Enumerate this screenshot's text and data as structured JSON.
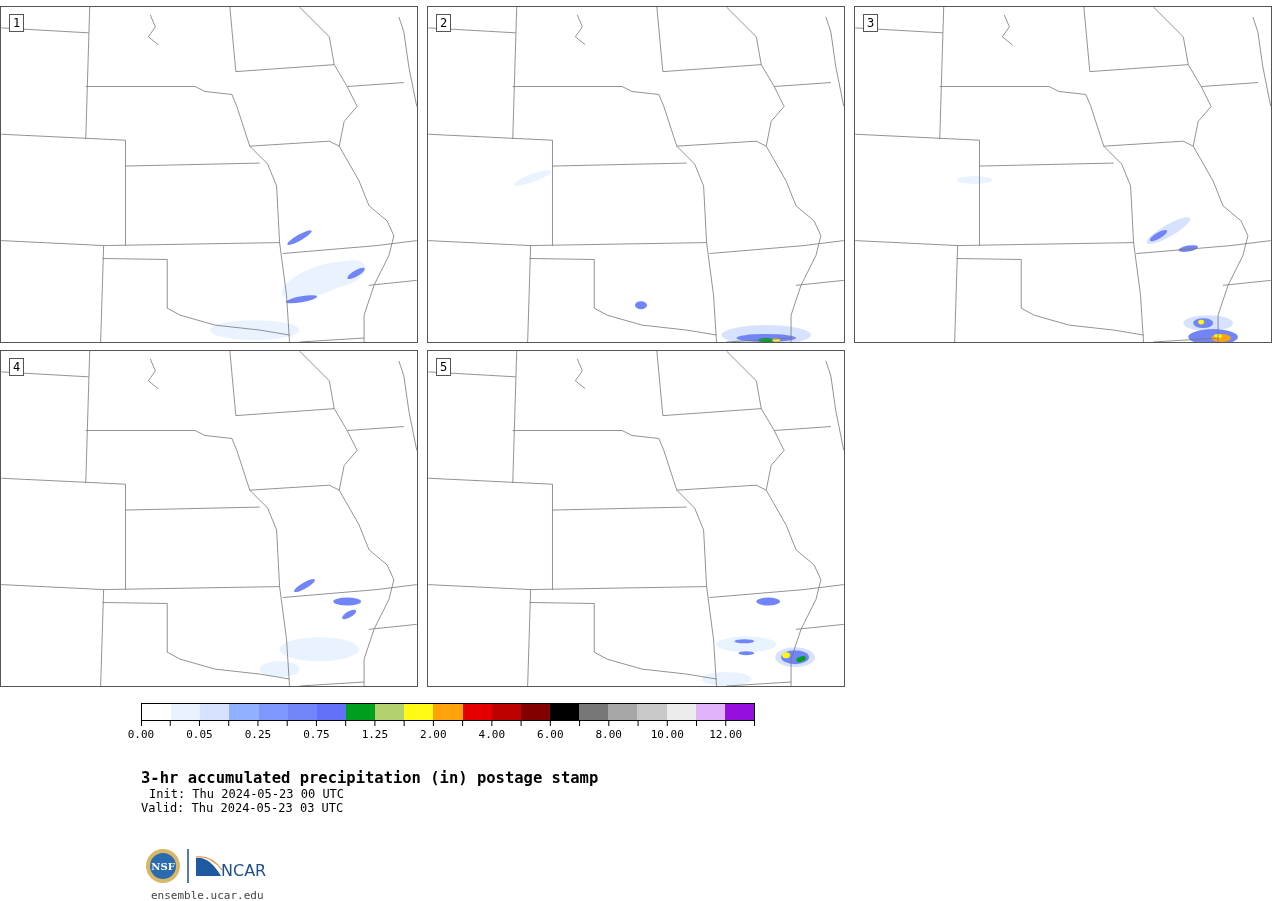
{
  "panels": [
    {
      "label": "1"
    },
    {
      "label": "2"
    },
    {
      "label": "3"
    },
    {
      "label": "4"
    },
    {
      "label": "5"
    }
  ],
  "colorbar": {
    "segments": [
      {
        "color": "#ffffff"
      },
      {
        "color": "#e8f3ff"
      },
      {
        "color": "#d6e2ff"
      },
      {
        "color": "#8fb1ff"
      },
      {
        "color": "#7f96ff"
      },
      {
        "color": "#7285f8"
      },
      {
        "color": "#6370f8"
      },
      {
        "color": "#009e1e"
      },
      {
        "color": "#b3d16e"
      },
      {
        "color": "#fff913"
      },
      {
        "color": "#ffa30a"
      },
      {
        "color": "#e50000"
      },
      {
        "color": "#bd0000"
      },
      {
        "color": "#820000"
      },
      {
        "color": "#000000"
      },
      {
        "color": "#777777"
      },
      {
        "color": "#a7a7a7"
      },
      {
        "color": "#c8c8c8"
      },
      {
        "color": "#ececec"
      },
      {
        "color": "#e1b4fa"
      },
      {
        "color": "#950fdf"
      }
    ],
    "labels": [
      "0.00",
      "0.05",
      "0.25",
      "0.75",
      "1.25",
      "2.00",
      "4.00",
      "6.00",
      "8.00",
      "10.00",
      "12.00"
    ]
  },
  "title": "3-hr accumulated precipitation (in) postage stamp",
  "init": "Init: Thu 2024-05-23 00 UTC",
  "valid": "Valid: Thu 2024-05-23 03 UTC",
  "logos": {
    "nsf": "NSF",
    "ncar": "NCAR"
  },
  "url": "ensemble.ucar.edu"
}
